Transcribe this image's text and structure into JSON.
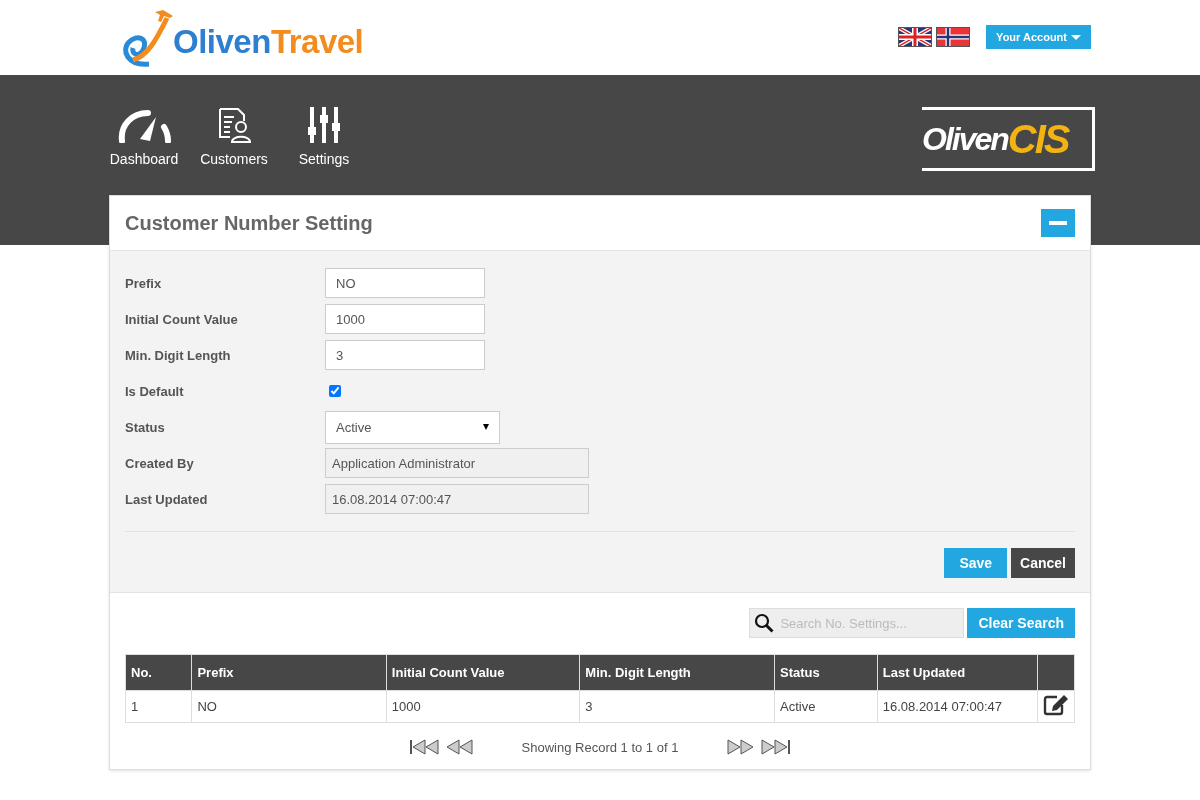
{
  "logo": {
    "part_1": "Oliven",
    "part_2": "Travel"
  },
  "languages": [
    {
      "kind": "uk",
      "selected": false
    },
    {
      "kind": "no",
      "selected": false
    }
  ],
  "account_button": "Your Account",
  "nav": [
    {
      "kind": "dashboard",
      "label": "Dashboard"
    },
    {
      "kind": "customers",
      "label": "Customers"
    },
    {
      "kind": "settings",
      "label": "Settings"
    }
  ],
  "brand_logo": {
    "part_1": "Oliven",
    "part_2": "CIS"
  },
  "panel": {
    "title": "Customer Number Setting",
    "fields": [
      {
        "kind": "text",
        "label": "Prefix",
        "value": "NO"
      },
      {
        "kind": "text",
        "label": "Initial Count Value",
        "value": "1000"
      },
      {
        "kind": "text",
        "label": "Min. Digit Length",
        "value": "3"
      },
      {
        "kind": "checkbox",
        "label": "Is Default",
        "checked": true
      },
      {
        "kind": "select",
        "label": "Status",
        "value": "Active"
      },
      {
        "kind": "readonly",
        "label": "Created By",
        "value": "Application Administrator"
      },
      {
        "kind": "readonly",
        "label": "Last Updated",
        "value": "16.08.2014 07:00:47"
      }
    ],
    "buttons": [
      {
        "kind": "primary",
        "label": "Save"
      },
      {
        "kind": "dark",
        "label": "Cancel"
      }
    ]
  },
  "search": {
    "placeholder": "Search No. Settings...",
    "clear_button": "Clear Search"
  },
  "table": {
    "columns": [
      "No.",
      "Prefix",
      "Initial Count Value",
      "Min. Digit Length",
      "Status",
      "Last Updated"
    ],
    "rows": [
      {
        "cells": [
          "1",
          "NO",
          "1000",
          "3",
          "Active",
          "16.08.2014 07:00:47"
        ]
      }
    ]
  },
  "pagination": {
    "text": "Showing Record 1 to 1 of 1"
  }
}
